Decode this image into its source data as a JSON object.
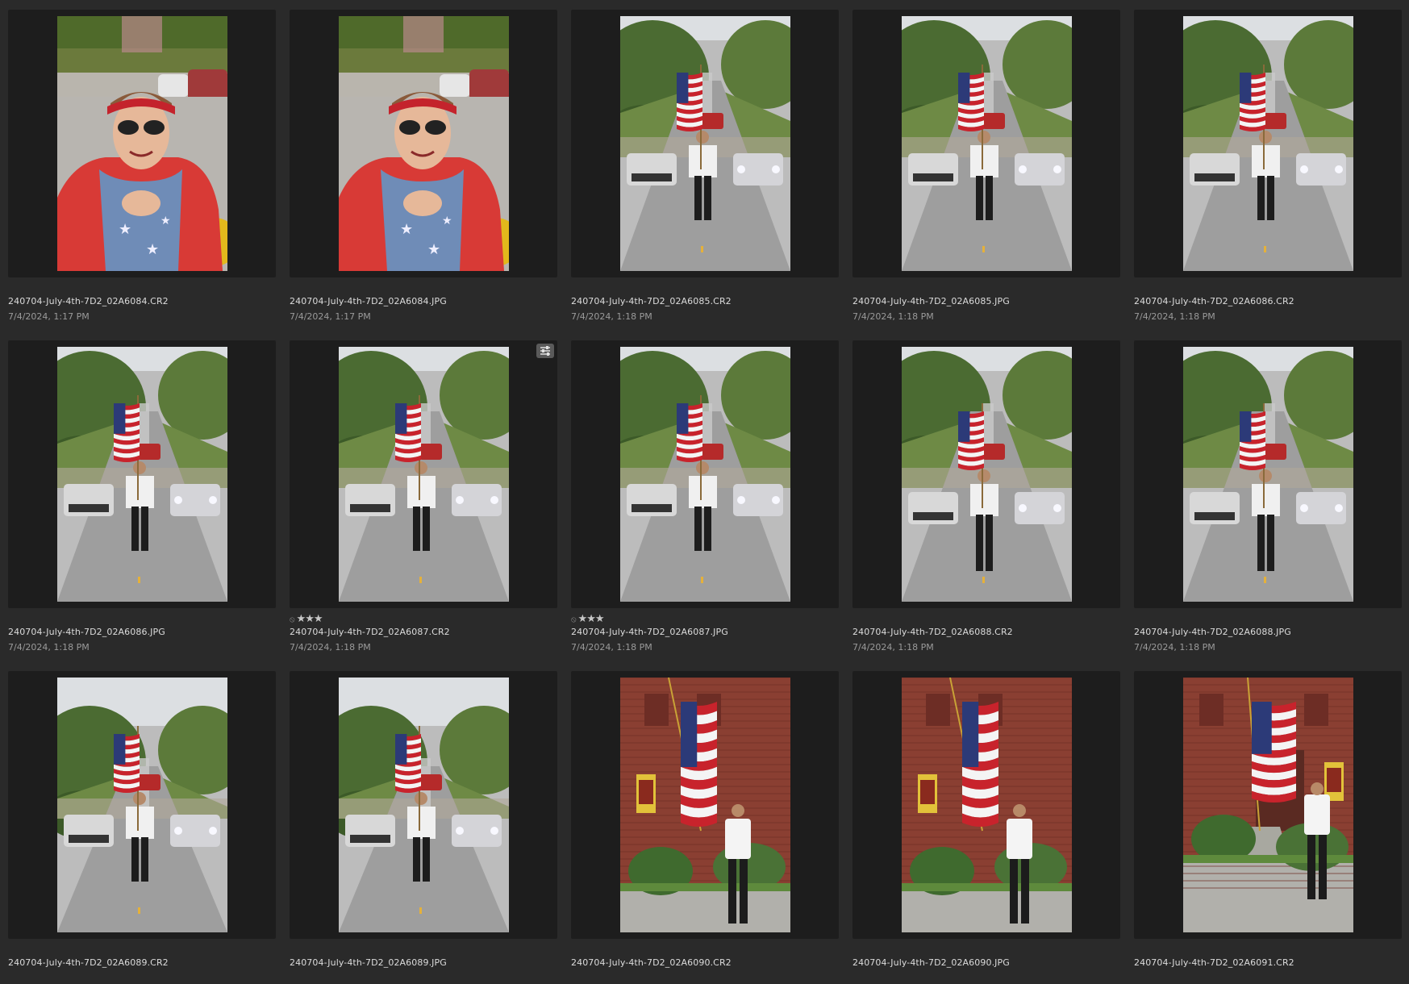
{
  "grid": {
    "items": [
      {
        "filename": "240704-July-4th-7D2_02A6084.CR2",
        "date": "7/4/2024, 1:17 PM",
        "scene": "girl",
        "rated": false,
        "edited": false
      },
      {
        "filename": "240704-July-4th-7D2_02A6084.JPG",
        "date": "7/4/2024, 1:17 PM",
        "scene": "girl",
        "rated": false,
        "edited": false
      },
      {
        "filename": "240704-July-4th-7D2_02A6085.CR2",
        "date": "7/4/2024, 1:18 PM",
        "scene": "parade",
        "rated": false,
        "edited": false
      },
      {
        "filename": "240704-July-4th-7D2_02A6085.JPG",
        "date": "7/4/2024, 1:18 PM",
        "scene": "parade",
        "rated": false,
        "edited": false
      },
      {
        "filename": "240704-July-4th-7D2_02A6086.CR2",
        "date": "7/4/2024, 1:18 PM",
        "scene": "parade",
        "rated": false,
        "edited": false
      },
      {
        "filename": "240704-July-4th-7D2_02A6086.JPG",
        "date": "7/4/2024, 1:18 PM",
        "scene": "parade",
        "rated": false,
        "edited": false
      },
      {
        "filename": "240704-July-4th-7D2_02A6087.CR2",
        "date": "7/4/2024, 1:18 PM",
        "scene": "parade",
        "rated": true,
        "edited": true
      },
      {
        "filename": "240704-July-4th-7D2_02A6087.JPG",
        "date": "7/4/2024, 1:18 PM",
        "scene": "parade",
        "rated": true,
        "edited": false
      },
      {
        "filename": "240704-July-4th-7D2_02A6088.CR2",
        "date": "7/4/2024, 1:18 PM",
        "scene": "parade-close",
        "rated": false,
        "edited": false
      },
      {
        "filename": "240704-July-4th-7D2_02A6088.JPG",
        "date": "7/4/2024, 1:18 PM",
        "scene": "parade-close",
        "rated": false,
        "edited": false
      },
      {
        "filename": "240704-July-4th-7D2_02A6089.CR2",
        "date": "",
        "scene": "parade-sky",
        "rated": false,
        "edited": false
      },
      {
        "filename": "240704-July-4th-7D2_02A6089.JPG",
        "date": "",
        "scene": "parade-sky",
        "rated": false,
        "edited": false
      },
      {
        "filename": "240704-July-4th-7D2_02A6090.CR2",
        "date": "",
        "scene": "brick",
        "rated": false,
        "edited": false
      },
      {
        "filename": "240704-July-4th-7D2_02A6090.JPG",
        "date": "",
        "scene": "brick",
        "rated": false,
        "edited": false
      },
      {
        "filename": "240704-July-4th-7D2_02A6091.CR2",
        "date": "",
        "scene": "brick-wide",
        "rated": false,
        "edited": false
      }
    ]
  },
  "rating": {
    "stars": 3,
    "max": 5,
    "reject_icon": "reject-icon",
    "star_icon": "star-icon"
  },
  "badge": {
    "icon": "adjustments-icon"
  },
  "colors": {
    "background": "#2a2a2a",
    "thumb_background": "#1d1d1d",
    "filename_text": "#dcdcdc",
    "date_text": "#9a9a9a"
  }
}
